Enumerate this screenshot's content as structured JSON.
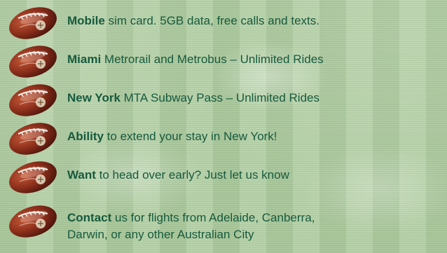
{
  "items": [
    {
      "bold": "Mobile",
      "text": " sim card.  5GB data, free calls and texts."
    },
    {
      "bold": "Miami",
      "text": " Metrorail and Metrobus – Unlimited Rides"
    },
    {
      "bold": "New York",
      "text": " MTA Subway Pass – Unlimited Rides"
    },
    {
      "bold": "Ability",
      "text": " to extend your stay in New York!"
    },
    {
      "bold": "Want",
      "text": " to head over early? Just let us know"
    },
    {
      "bold": "Contact",
      "text": " us for flights from Adelaide, Canberra,",
      "line2": "Darwin, or any  other Australian City"
    }
  ],
  "icons": {
    "bullet": "football-icon"
  },
  "colors": {
    "text": "#165a3d",
    "ball": "#8d2f1b"
  }
}
